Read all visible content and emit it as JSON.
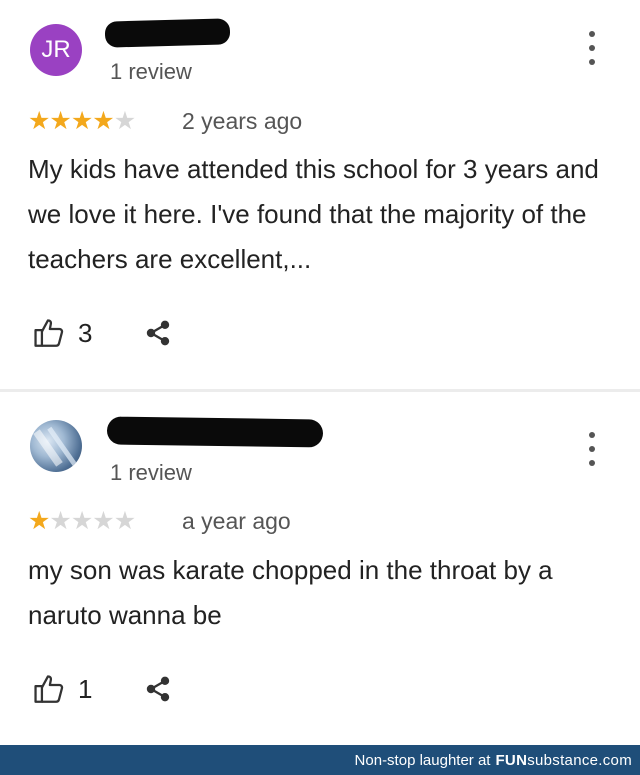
{
  "reviews": [
    {
      "avatar_initials": "JR",
      "avatar_color": "#9a41c2",
      "review_count": "1 review",
      "rating": 4,
      "max_rating": 5,
      "date": "2 years ago",
      "text": "My kids have attended this school for 3 years and we love it here.  I've found that the majority of the teachers are excellent,...",
      "likes": "3"
    },
    {
      "avatar_initials": "",
      "review_count": "1 review",
      "rating": 1,
      "max_rating": 5,
      "date": "a year ago",
      "text": "my son was karate chopped in the throat by a naruto wanna be",
      "likes": "1"
    }
  ],
  "colors": {
    "star_filled": "#f3a81c",
    "star_empty": "#d6d6d6",
    "footer_bg": "#1f4e79"
  },
  "footer": {
    "prefix": "Non-stop laughter at",
    "brand_bold": "FUN",
    "brand_rest": "substance.com"
  }
}
